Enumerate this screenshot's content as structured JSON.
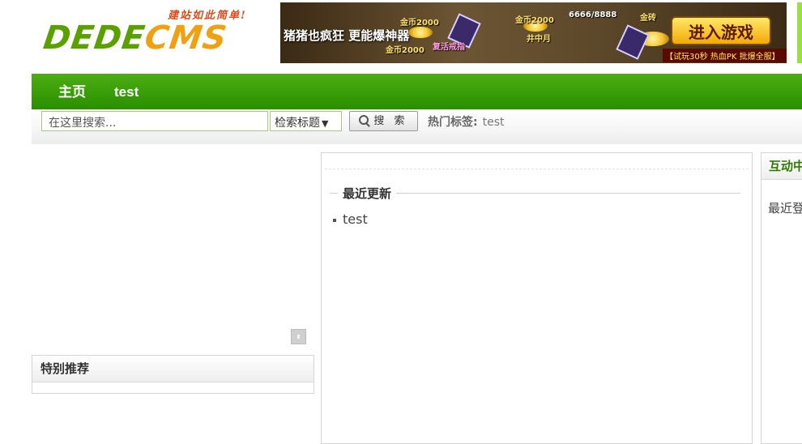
{
  "header": {
    "logo": {
      "slogan": "建站如此简单!",
      "word_main": "DEDE",
      "word_accent": "CMS"
    },
    "banner": {
      "tagline": "猪猪也疯狂 更能爆神器",
      "labels": [
        "金币2000",
        "金币2000",
        "金币2000",
        "复活戒指",
        "井中月",
        "6666/8888",
        "金砖"
      ],
      "cta": "进入游戏",
      "fine_print": "【试玩30秒 热血PK 批爆全服】"
    }
  },
  "nav": {
    "items": [
      {
        "label": "主页"
      },
      {
        "label": "test"
      }
    ]
  },
  "search": {
    "placeholder": "在这里搜索...",
    "select_value": "检索标题",
    "button_label": "搜 索",
    "hot_tags_label": "热门标签:",
    "hot_tags": [
      "test"
    ]
  },
  "left": {
    "special_title": "特别推荐"
  },
  "center": {
    "section_title": "最近更新",
    "items": [
      "test"
    ]
  },
  "right": {
    "title": "互动中心",
    "recent_label": "最近登录"
  }
}
